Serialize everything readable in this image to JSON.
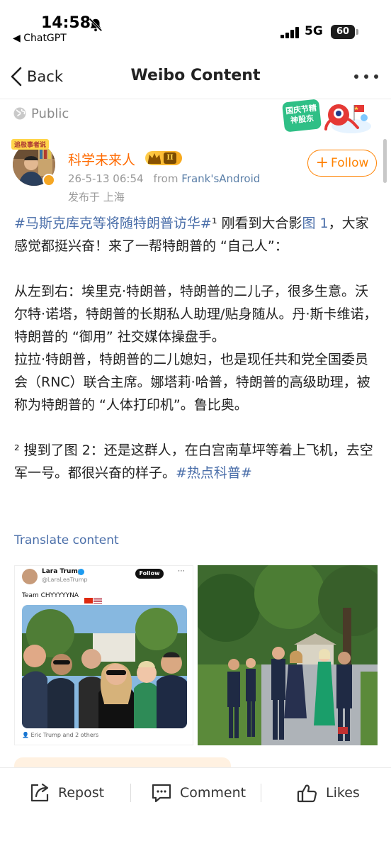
{
  "status_bar": {
    "time": "14:58",
    "back_app": "ChatGPT",
    "network": "5G",
    "battery": "60"
  },
  "nav": {
    "back_label": "Back",
    "title": "Weibo Content"
  },
  "visibility": {
    "label": "Public",
    "promo": "国庆节精神股东"
  },
  "post": {
    "avatar_tag": "追极事者说",
    "username": "科学未来人",
    "level": "II",
    "timestamp": "26-5-13 06:54",
    "from_label": "from",
    "device": "Frank'sAndroid",
    "location": "发布于 上海",
    "follow_label": "Follow",
    "body": {
      "hashtag1": "#马斯克库克等将随特朗普访华#",
      "seg1": "¹ 刚看到大合影",
      "link1": "图 1",
      "seg2": "，大家感觉都挺兴奋！来了一帮特朗普的 “自己人”：",
      "para2": "从左到右：埃里克·特朗普，特朗普的二儿子，很多生意。沃尔特·诺塔，特朗普的长期私人助理/贴身随从。丹·斯卡维诺，特朗普的 “御用” 社交媒体操盘手。",
      "para3": "拉拉·特朗普，特朗普的二儿媳妇，也是现任共和党全国委员会（RNC）联合主席。娜塔莉·哈普，特朗普的高级助理，被称为特朗普的 “人体打印机”。鲁比奥。",
      "seg3": "² 搜到了图 2：还是这群人，在白宫南草坪等着上飞机，去空军一号。都很兴奋的样子。",
      "hashtag2": "#热点科普#"
    },
    "translate_label": "Translate content",
    "image1": {
      "name": "Lara Trump",
      "handle": "@LaraLeaTrump",
      "follow": "Follow",
      "caption": "Team CHYYYYYNA",
      "footer": "Eric Trump and 2 others"
    }
  },
  "actions": {
    "repost": "Repost",
    "comment": "Comment",
    "likes": "Likes"
  }
}
